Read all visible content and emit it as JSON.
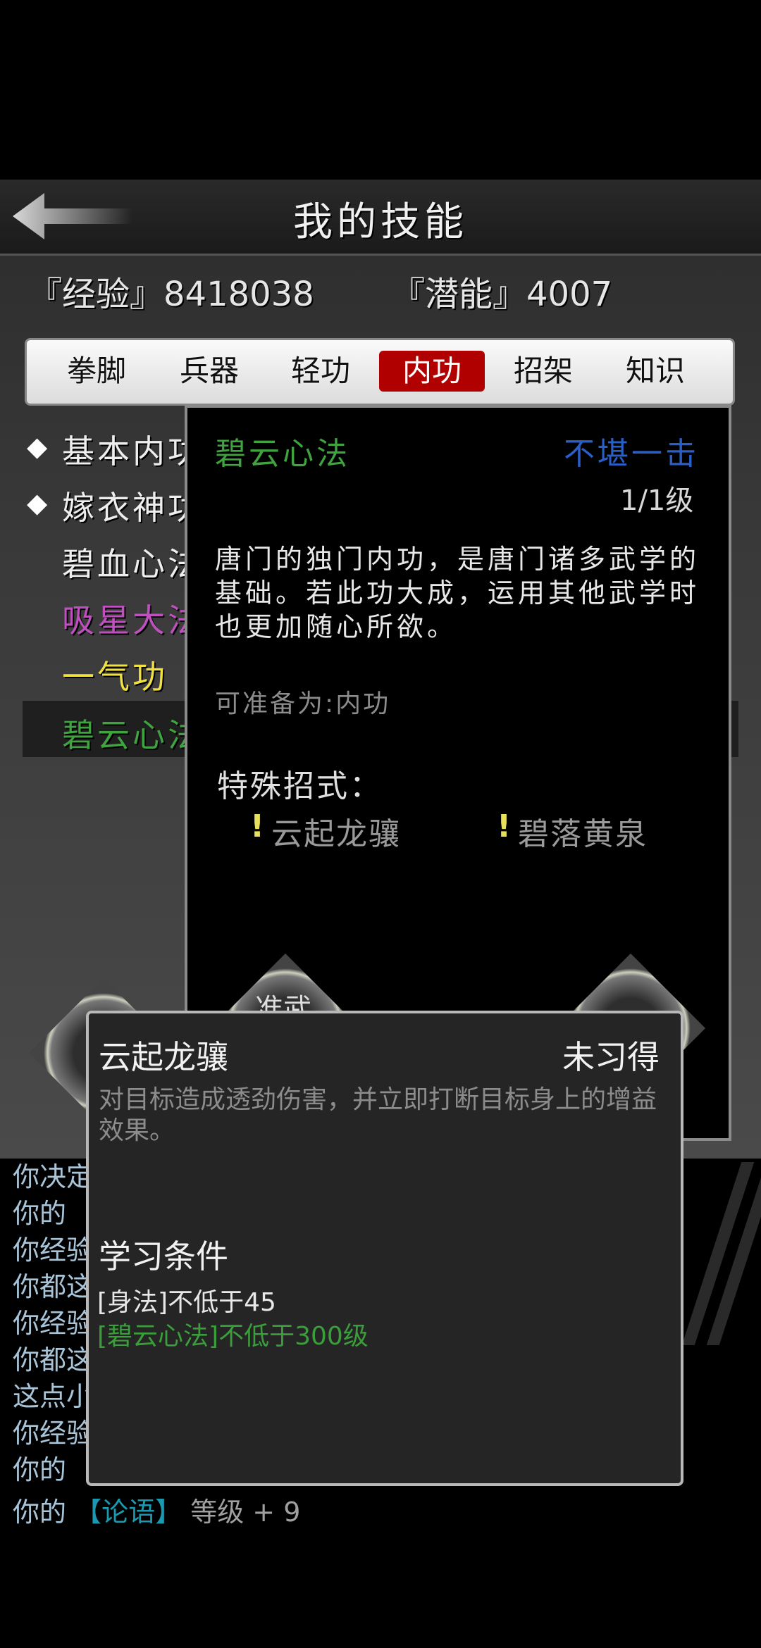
{
  "header": {
    "title": "我的技能"
  },
  "stats": {
    "experience": "『经验』8418038",
    "potential": "『潜能』4007"
  },
  "tabs": [
    "拳脚",
    "兵器",
    "轻功",
    "内功",
    "招架",
    "知识"
  ],
  "active_tab": "内功",
  "skill_list": [
    {
      "label": "基本内功",
      "color": "#eeeeee",
      "marked": true
    },
    {
      "label": "嫁衣神功",
      "color": "#eeeeee",
      "marked": true
    },
    {
      "label": "碧血心法",
      "color": "#eeeeee",
      "marked": false
    },
    {
      "label": "吸星大法",
      "color": "#c050c0",
      "marked": false
    },
    {
      "label": "一气功",
      "color": "#f0e040",
      "marked": false
    },
    {
      "label": "碧云心法",
      "color": "#3fa33f",
      "marked": false,
      "selected": true
    }
  ],
  "detail": {
    "name": "碧云心法",
    "rank": "不堪一击",
    "level": "1/1级",
    "description": "唐门的独门内功，是唐门诸多武学的基础。若此功大成，运用其他武学时也更加随心所欲。",
    "equippable": "可准备为:内功",
    "special_label": "特殊招式：",
    "special_moves": [
      "云起龙骧",
      "碧落黄泉"
    ],
    "button_partial": "准武"
  },
  "move_popup": {
    "name": "云起龙骧",
    "status": "未习得",
    "description": "对目标造成透劲伤害，并立即打断目标身上的增益效果。",
    "conditions_label": "学习条件",
    "conditions": [
      "[身法]不低于45",
      "[碧云心法]不低于300级"
    ]
  },
  "log": {
    "lines": [
      "你决定",
      "你的",
      "你经验",
      "你都这",
      "你经验",
      "你都这",
      "这点小",
      "你经验",
      "你的"
    ],
    "last_line": {
      "prefix": "你的",
      "tag": "【论语】",
      "suffix": "等级 + 9"
    }
  },
  "colors": {
    "active_tab": "#b10000",
    "green": "#3fa33f",
    "blue": "#2a5fc8",
    "yellow": "#e6e05a"
  }
}
